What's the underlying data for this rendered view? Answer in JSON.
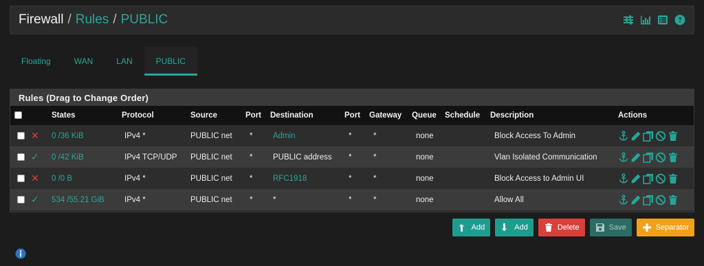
{
  "breadcrumb": {
    "root": "Firewall",
    "sep1": "/",
    "item1": "Rules",
    "sep2": "/",
    "item2": "PUBLIC"
  },
  "tabs": [
    {
      "label": "Floating"
    },
    {
      "label": "WAN"
    },
    {
      "label": "LAN"
    },
    {
      "label": "PUBLIC",
      "active": true
    }
  ],
  "panel": {
    "title": "Rules (Drag to Change Order)"
  },
  "table": {
    "headers": {
      "states": "States",
      "protocol": "Protocol",
      "source": "Source",
      "port": "Port",
      "destination": "Destination",
      "dport": "Port",
      "gateway": "Gateway",
      "queue": "Queue",
      "schedule": "Schedule",
      "description": "Description",
      "actions": "Actions"
    },
    "rows": [
      {
        "status": "block",
        "status_icon": "x-icon",
        "states": "0 /36 KiB",
        "protocol": "IPv4 *",
        "source": "PUBLIC net",
        "port": "*",
        "destination": "Admin",
        "dest_link": true,
        "dport": "*",
        "gateway": "*",
        "queue": "none",
        "schedule": "",
        "description": "Block Access To Admin"
      },
      {
        "status": "pass",
        "status_icon": "check-icon",
        "states": "0 /42 KiB",
        "protocol": "IPv4 TCP/UDP",
        "source": "PUBLIC net",
        "port": "*",
        "destination": "PUBLIC address",
        "dest_link": false,
        "dport": "*",
        "gateway": "*",
        "queue": "none",
        "schedule": "",
        "description": "Vlan Isolated Communication"
      },
      {
        "status": "block",
        "status_icon": "x-icon",
        "states": "0 /0 B",
        "protocol": "IPv4 *",
        "source": "PUBLIC net",
        "port": "*",
        "destination": "RFC1918",
        "dest_link": true,
        "dport": "*",
        "gateway": "*",
        "queue": "none",
        "schedule": "",
        "description": "Block Access to Admin UI"
      },
      {
        "status": "pass",
        "status_icon": "check-icon",
        "states": "534 /55.21 GiB",
        "protocol": "IPv4 *",
        "source": "PUBLIC net",
        "port": "*",
        "destination": "*",
        "dest_link": false,
        "dport": "*",
        "gateway": "*",
        "queue": "none",
        "schedule": "",
        "description": "Allow All"
      }
    ]
  },
  "buttons": {
    "add_top": "Add",
    "add_bottom": "Add",
    "delete": "Delete",
    "save": "Save",
    "separator": "Separator"
  },
  "colors": {
    "accent": "#2aa699",
    "block": "#d9403a",
    "pass": "#2aa669",
    "delete": "#d9403a",
    "separator": "#f0a11a"
  }
}
